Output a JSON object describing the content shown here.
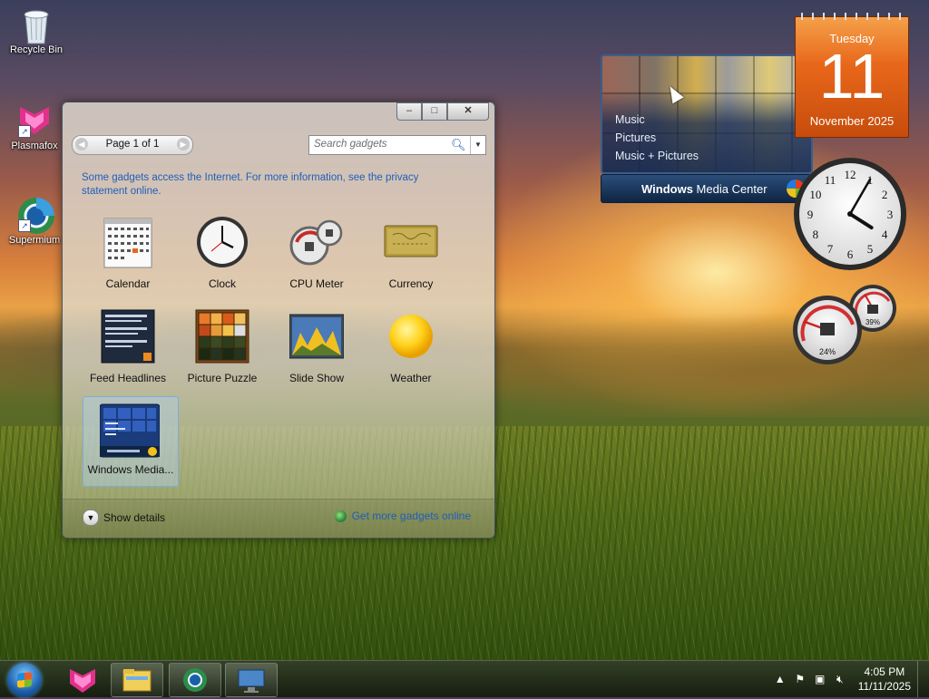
{
  "desktop": {
    "icons": [
      {
        "label": "Recycle Bin",
        "icon": "recycle-bin-icon"
      },
      {
        "label": "Plasmafox",
        "icon": "plasmafox-icon"
      },
      {
        "label": "Supermium",
        "icon": "supermium-icon"
      }
    ]
  },
  "gallery": {
    "window_buttons": {
      "minimize": "–",
      "maximize": "□",
      "close": "✕"
    },
    "pager": {
      "text": "Page 1 of 1",
      "prev": "◀",
      "next": "▶"
    },
    "search": {
      "placeholder": "Search gadgets",
      "dropdown": "▼"
    },
    "info_text": "Some gadgets access the Internet.  For more information, see the privacy statement online.",
    "gadgets": [
      {
        "label": "Calendar",
        "icon": "calendar-gadget-icon"
      },
      {
        "label": "Clock",
        "icon": "clock-gadget-icon"
      },
      {
        "label": "CPU Meter",
        "icon": "cpu-meter-gadget-icon"
      },
      {
        "label": "Currency",
        "icon": "currency-gadget-icon"
      },
      {
        "label": "Feed Headlines",
        "icon": "feed-headlines-gadget-icon"
      },
      {
        "label": "Picture Puzzle",
        "icon": "picture-puzzle-gadget-icon"
      },
      {
        "label": "Slide Show",
        "icon": "slide-show-gadget-icon"
      },
      {
        "label": "Weather",
        "icon": "weather-gadget-icon"
      },
      {
        "label": "Windows Media...",
        "icon": "windows-media-center-gadget-icon",
        "selected": true
      }
    ],
    "footer": {
      "show_details": "Show details",
      "get_more": "Get more gadgets online"
    }
  },
  "calendar_gadget": {
    "weekday": "Tuesday",
    "day": "11",
    "month_year": "November 2025"
  },
  "media_center_gadget": {
    "menu": [
      "Music",
      "Pictures",
      "Music + Pictures"
    ],
    "title_bold": "Windows",
    "title_rest": " Media Center"
  },
  "clock_gadget": {
    "hour": 4,
    "minute": 5,
    "numerals": [
      "12",
      "1",
      "2",
      "3",
      "4",
      "5",
      "6",
      "7",
      "8",
      "9",
      "10",
      "11"
    ]
  },
  "cpu_meter_gadget": {
    "cpu_percent": 24,
    "memory_percent": 39,
    "cpu_label": "24%",
    "memory_label": "39%"
  },
  "taskbar": {
    "apps": [
      "plasmafox",
      "windows-explorer",
      "supermium",
      "remote-desktop"
    ],
    "time": "4:05 PM",
    "date": "11/11/2025",
    "tray_icons": [
      "show-hidden-icons",
      "action-center-icon",
      "network-icon",
      "volume-muted-icon"
    ]
  },
  "colors": {
    "link": "#1f5fb8",
    "calendar_orange": "#e8671a",
    "wmc_blue": "#1f3d66"
  }
}
